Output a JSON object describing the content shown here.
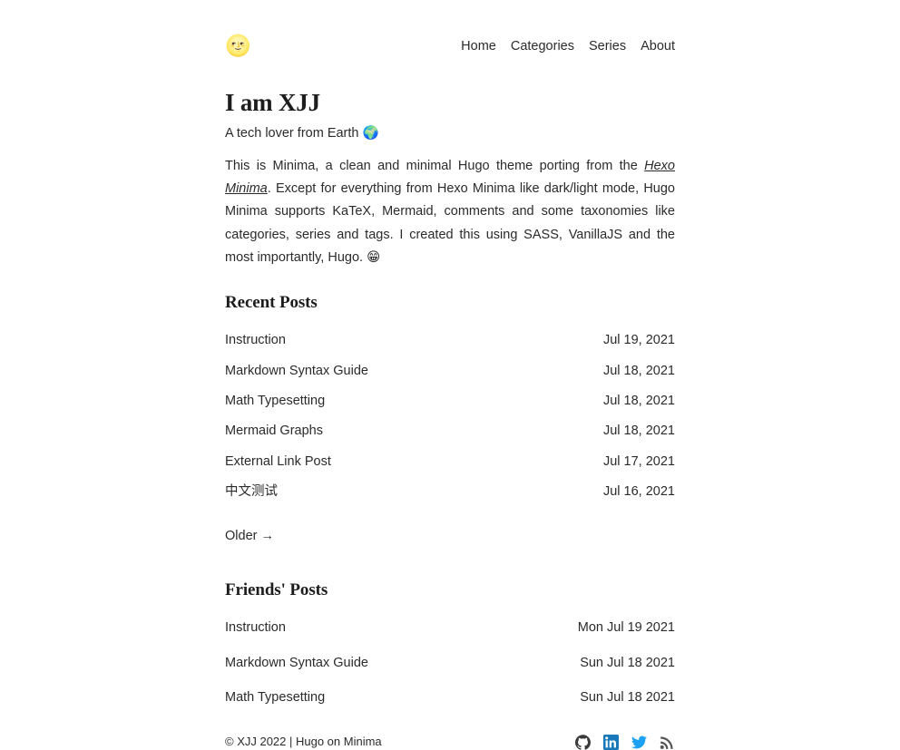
{
  "header": {
    "logo_emoji": "🌝",
    "logo_icon_name": "moon-face-logo",
    "nav": [
      {
        "label": "Home"
      },
      {
        "label": "Categories"
      },
      {
        "label": "Series"
      },
      {
        "label": "About"
      }
    ]
  },
  "intro": {
    "title": "I am XJJ",
    "subtitle_text": "A tech lover from Earth",
    "subtitle_emoji": "🌍",
    "body_part1": "This is Minima, a clean and minimal Hugo theme porting from the ",
    "body_link": "Hexo Minima",
    "body_part2": ". Except for everything from Hexo Minima like dark/light mode, Hugo Minima supports KaTeX, Mermaid, comments and some taxonomies like categories, series and tags. I created this using SASS, VanillaJS and the most importantly, Hugo. ",
    "body_emoji": "😁"
  },
  "recent": {
    "heading": "Recent Posts",
    "posts": [
      {
        "title": "Instruction",
        "date": "Jul 19, 2021"
      },
      {
        "title": "Markdown Syntax Guide",
        "date": "Jul 18, 2021"
      },
      {
        "title": "Math Typesetting",
        "date": "Jul 18, 2021"
      },
      {
        "title": "Mermaid Graphs",
        "date": "Jul 18, 2021"
      },
      {
        "title": "External Link Post",
        "date": "Jul 17, 2021"
      },
      {
        "title": "中文测试",
        "date": "Jul 16, 2021"
      }
    ],
    "older_label": "Older →"
  },
  "friends": {
    "heading": "Friends' Posts",
    "posts": [
      {
        "title": "Instruction",
        "date": "Mon Jul 19 2021"
      },
      {
        "title": "Markdown Syntax Guide",
        "date": "Sun Jul 18 2021"
      },
      {
        "title": "Math Typesetting",
        "date": "Sun Jul 18 2021"
      }
    ]
  },
  "footer": {
    "copyright": "© XJJ 2022 | Hugo on Minima",
    "social": [
      {
        "name": "github",
        "color": "#3a3a3a"
      },
      {
        "name": "linkedin",
        "color": "#1878b9"
      },
      {
        "name": "twitter",
        "color": "#1da1f2"
      },
      {
        "name": "rss",
        "color": "#555555"
      }
    ]
  }
}
